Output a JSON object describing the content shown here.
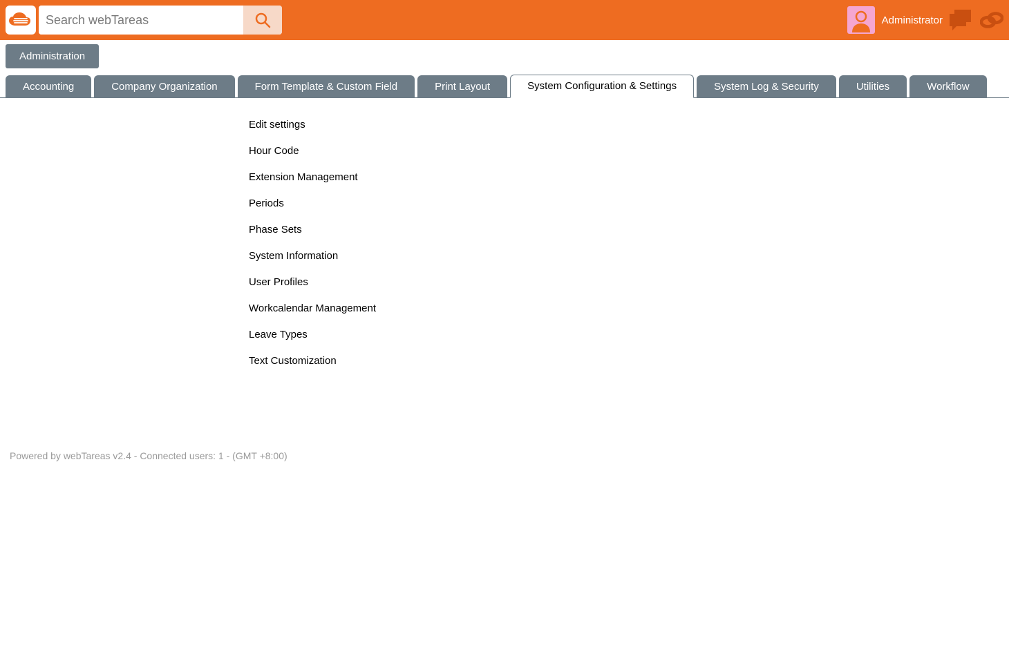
{
  "search": {
    "placeholder": "Search webTareas"
  },
  "user": {
    "name": "Administrator"
  },
  "breadcrumb": {
    "label": "Administration"
  },
  "tabs": [
    {
      "label": "Accounting",
      "active": false
    },
    {
      "label": "Company Organization",
      "active": false
    },
    {
      "label": "Form Template & Custom Field",
      "active": false
    },
    {
      "label": "Print Layout",
      "active": false
    },
    {
      "label": "System Configuration & Settings",
      "active": true
    },
    {
      "label": "System Log & Security",
      "active": false
    },
    {
      "label": "Utilities",
      "active": false
    },
    {
      "label": "Workflow",
      "active": false
    }
  ],
  "menu": [
    {
      "label": "Edit settings"
    },
    {
      "label": "Hour Code"
    },
    {
      "label": "Extension Management"
    },
    {
      "label": "Periods"
    },
    {
      "label": "Phase Sets"
    },
    {
      "label": "System Information"
    },
    {
      "label": "User Profiles"
    },
    {
      "label": "Workcalendar Management"
    },
    {
      "label": "Leave Types"
    },
    {
      "label": "Text Customization"
    }
  ],
  "footer": {
    "text": "Powered by webTareas v2.4 - Connected users: 1 - (GMT +8:00)"
  }
}
